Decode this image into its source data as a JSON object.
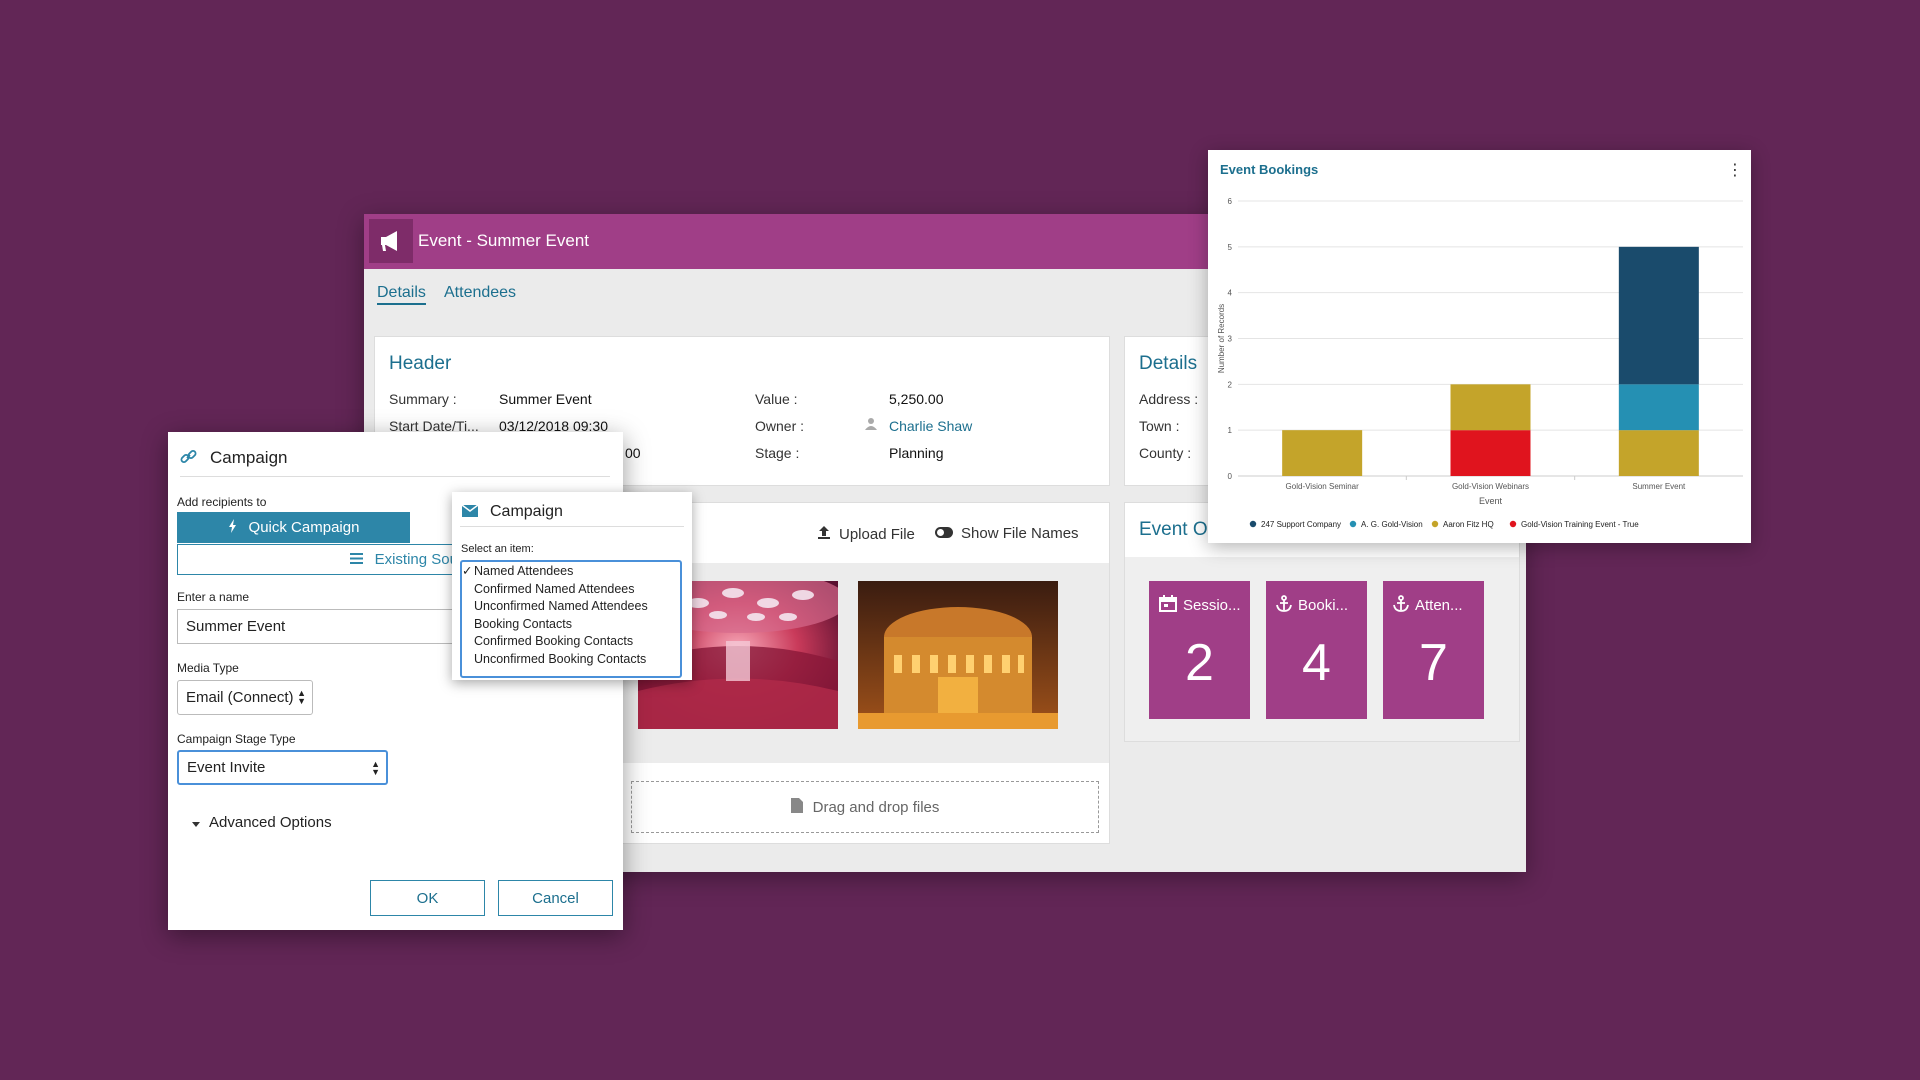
{
  "event": {
    "title": "Event - Summer Event",
    "tabs": [
      {
        "label": "Details"
      },
      {
        "label": "Attendees"
      }
    ],
    "header": {
      "title": "Header",
      "summary_label": "Summary :",
      "summary_value": "Summer Event",
      "start_label": "Start Date/Ti...",
      "start_value": "03/12/2018 09:30",
      "end_value": "00",
      "value_label": "Value :",
      "value_value": "5,250.00",
      "owner_label": "Owner :",
      "owner_value": "Charlie Shaw",
      "stage_label": "Stage :",
      "stage_value": "Planning"
    },
    "details": {
      "title": "Details",
      "address_label": "Address :",
      "town_label": "Town :",
      "county_label": "County :"
    },
    "files": {
      "upload_label": "Upload File",
      "show_names_label": "Show File Names",
      "dropzone_label": "Drag and drop files"
    },
    "overview": {
      "title": "Event O",
      "tiles": [
        {
          "label": "Sessio...",
          "count": "2",
          "icon": "calendar-icon"
        },
        {
          "label": "Booki...",
          "count": "4",
          "icon": "anchor-icon"
        },
        {
          "label": "Atten...",
          "count": "7",
          "icon": "anchor-icon"
        }
      ]
    }
  },
  "chart": {
    "menu_glyph": "⋮"
  },
  "chart_data": {
    "type": "bar",
    "stacked": true,
    "title": "Event Bookings",
    "xlabel": "Event",
    "ylabel": "Number of Records",
    "categories": [
      "Gold-Vision Seminar",
      "Gold-Vision Webinars",
      "Summer Event"
    ],
    "ylim": [
      0,
      6
    ],
    "yticks": [
      0,
      1,
      2,
      3,
      4,
      5,
      6
    ],
    "series": [
      {
        "name": "247 Support Company",
        "color": "#1a4b6c",
        "values": [
          0,
          0,
          3
        ]
      },
      {
        "name": "A. G. Gold-Vision",
        "color": "#2590b3",
        "values": [
          0,
          0,
          1
        ]
      },
      {
        "name": "Aaron Fitz HQ",
        "color": "#c4a42a",
        "values": [
          1,
          1,
          1
        ]
      },
      {
        "name": "Gold-Vision Training Event - True",
        "color": "#e0141e",
        "values": [
          0,
          1,
          0
        ]
      }
    ],
    "stack_order": [
      3,
      2,
      1,
      0
    ],
    "legend_position": "bottom"
  },
  "campaign": {
    "title": "Campaign",
    "add_recipients_label": "Add recipients to",
    "quick_campaign_label": "Quick Campaign",
    "existing_source_label": "Existing Sourc",
    "name_label": "Enter a name",
    "name_value": "Summer Event",
    "media_type_label": "Media Type",
    "media_type_value": "Email (Connect)",
    "stage_type_label": "Campaign Stage Type",
    "stage_type_value": "Event Invite",
    "advanced_label": "Advanced Options",
    "ok_label": "OK",
    "cancel_label": "Cancel"
  },
  "popup": {
    "title": "Campaign",
    "select_label": "Select an item:",
    "items": [
      {
        "label": "Named Attendees",
        "checked": true
      },
      {
        "label": "Confirmed Named Attendees",
        "checked": false
      },
      {
        "label": "Unconfirmed Named Attendees",
        "checked": false
      },
      {
        "label": "Booking Contacts",
        "checked": false
      },
      {
        "label": "Confirmed Booking Contacts",
        "checked": false
      },
      {
        "label": "Unconfirmed Booking Contacts",
        "checked": false
      }
    ]
  }
}
